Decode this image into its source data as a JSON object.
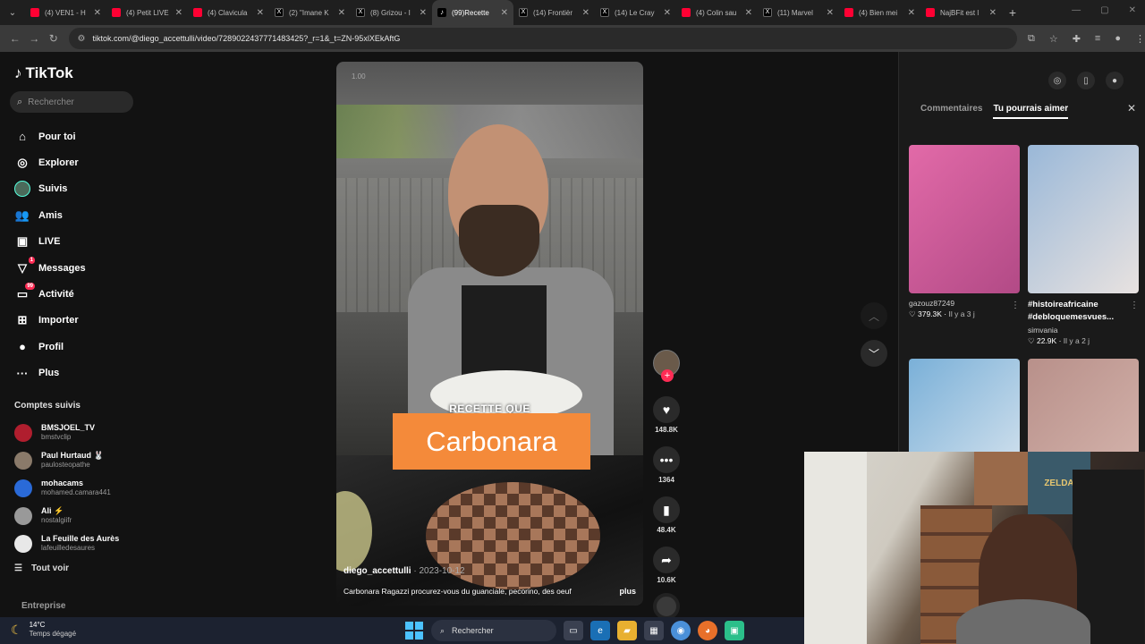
{
  "browser": {
    "tabs": [
      {
        "label": "(4) VEN1 - H",
        "type": "yt"
      },
      {
        "label": "(4) Petit LIVE",
        "type": "yt"
      },
      {
        "label": "(4) Clavicula",
        "type": "yt"
      },
      {
        "label": "(2) \"Imane K",
        "type": "x"
      },
      {
        "label": "(8) Grizou - I",
        "type": "x"
      },
      {
        "label": "(99)Recette",
        "type": "tt",
        "active": true
      },
      {
        "label": "(14) Frontièr",
        "type": "x"
      },
      {
        "label": "(14) Le Cray",
        "type": "x"
      },
      {
        "label": "(4) Colin sau",
        "type": "yt"
      },
      {
        "label": "(11) Marvel",
        "type": "x"
      },
      {
        "label": "(4) Bien mei",
        "type": "yt"
      },
      {
        "label": "NajBFit est l",
        "type": "yt"
      }
    ],
    "url": "tiktok.com/@diego_accettulli/video/7289022437771483425?_r=1&_t=ZN-95xlXEkAftG"
  },
  "sidebar": {
    "logo": "TikTok",
    "search_placeholder": "Rechercher",
    "nav": [
      {
        "label": "Pour toi",
        "icon": "home-icon",
        "glyph": "⌂"
      },
      {
        "label": "Explorer",
        "icon": "compass-icon",
        "glyph": "◎"
      },
      {
        "label": "Suivis",
        "icon": "following-avatar-icon",
        "glyph": ""
      },
      {
        "label": "Amis",
        "icon": "friends-icon",
        "glyph": "👥"
      },
      {
        "label": "LIVE",
        "icon": "live-icon",
        "glyph": "▣"
      },
      {
        "label": "Messages",
        "icon": "messages-icon",
        "glyph": "▽",
        "badge": "1"
      },
      {
        "label": "Activité",
        "icon": "activity-icon",
        "glyph": "▭",
        "badge": "99"
      },
      {
        "label": "Importer",
        "icon": "upload-icon",
        "glyph": "⊞"
      },
      {
        "label": "Profil",
        "icon": "profile-icon",
        "glyph": "●"
      },
      {
        "label": "Plus",
        "icon": "more-icon",
        "glyph": "···"
      }
    ],
    "following_heading": "Comptes suivis",
    "following": [
      {
        "name": "BMSJOEL_TV",
        "handle": "bmstvclip",
        "color": "#b01e2e"
      },
      {
        "name": "Paul Hurtaud 🐰",
        "handle": "paulosteopathe",
        "color": "#8a7a6a"
      },
      {
        "name": "mohacams",
        "handle": "mohamed.camara441",
        "color": "#2a6ad8"
      },
      {
        "name": "Ali ⚡",
        "handle": "nostalgiifr",
        "color": "#999999"
      },
      {
        "name": "La Feuille des Aurès",
        "handle": "lafeuilledesaures",
        "color": "#e8e8e8"
      }
    ],
    "see_all": "Tout voir",
    "footer": "Entreprise"
  },
  "video": {
    "speed": "1.00",
    "overlay_subtitle": "RECETTE QUE",
    "overlay_title": "Carbonara",
    "author": "diego_accettulli",
    "date": "2023-10-12",
    "description": "Carbonara Ragazzi procurez-vous du guanciale, pecorino, des oeuf",
    "more": "plus"
  },
  "actions": {
    "likes": "148.8K",
    "comments": "1364",
    "saves": "48.4K",
    "shares": "10.6K"
  },
  "panel": {
    "tabs": [
      "Commentaires",
      "Tu pourrais aimer"
    ],
    "active_tab": 1,
    "cards": [
      {
        "caption": "",
        "user": "gazouz87249",
        "likes": "379.3K",
        "ago": "Il y a 3 j",
        "colors": [
          "#e26aa8",
          "#b24a86"
        ]
      },
      {
        "caption": "#histoireafricaine #debloquemesvues...",
        "user": "simvania",
        "likes": "22.9K",
        "ago": "Il y a 2 j",
        "colors": [
          "#9ab8d8",
          "#e8e2e0"
        ]
      },
      {
        "caption": "",
        "user": "",
        "likes": "",
        "ago": "",
        "colors": [
          "#7ab0d8",
          "#dfe8f0"
        ]
      },
      {
        "caption": "",
        "user": "",
        "likes": "",
        "ago": "",
        "colors": [
          "#b8908a",
          "#d8b8b0"
        ]
      }
    ]
  },
  "webcam": {
    "poster_text": "ZELDA"
  },
  "taskbar": {
    "temp": "14°C",
    "weather": "Temps dégagé",
    "search": "Rechercher"
  }
}
